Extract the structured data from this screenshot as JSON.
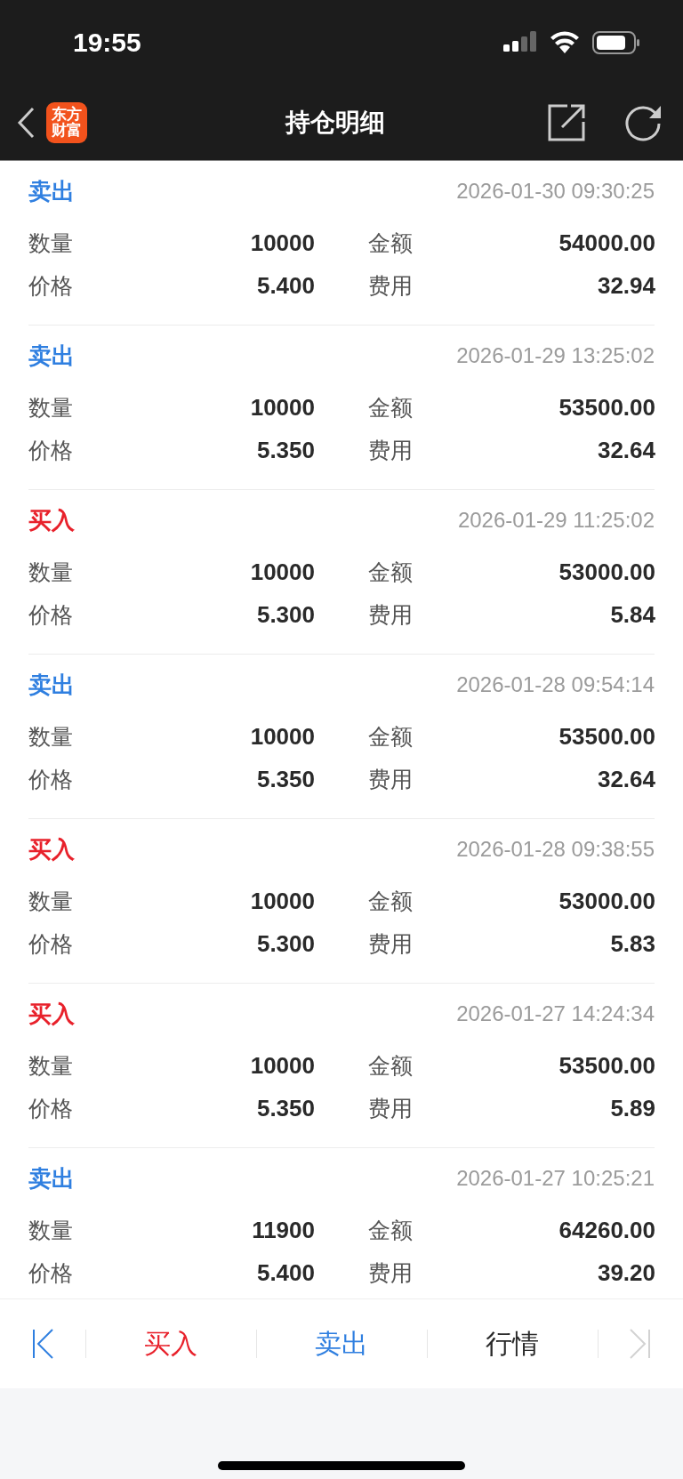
{
  "status_bar": {
    "time": "19:55"
  },
  "header": {
    "logo_lines": [
      "东方",
      "财富"
    ],
    "title": "持仓明细"
  },
  "records": [
    {
      "side": {
        "kind": "sell",
        "label": "卖出"
      },
      "time": "2026-01-30 09:30:25",
      "fields": [
        {
          "label": "数量",
          "value": "10000"
        },
        {
          "label": "金额",
          "value": "54000.00"
        },
        {
          "label": "价格",
          "value": "5.400"
        },
        {
          "label": "费用",
          "value": "32.94"
        }
      ]
    },
    {
      "side": {
        "kind": "sell",
        "label": "卖出"
      },
      "time": "2026-01-29 13:25:02",
      "fields": [
        {
          "label": "数量",
          "value": "10000"
        },
        {
          "label": "金额",
          "value": "53500.00"
        },
        {
          "label": "价格",
          "value": "5.350"
        },
        {
          "label": "费用",
          "value": "32.64"
        }
      ]
    },
    {
      "side": {
        "kind": "buy",
        "label": "买入"
      },
      "time": "2026-01-29 11:25:02",
      "fields": [
        {
          "label": "数量",
          "value": "10000"
        },
        {
          "label": "金额",
          "value": "53000.00"
        },
        {
          "label": "价格",
          "value": "5.300"
        },
        {
          "label": "费用",
          "value": "5.84"
        }
      ]
    },
    {
      "side": {
        "kind": "sell",
        "label": "卖出"
      },
      "time": "2026-01-28 09:54:14",
      "fields": [
        {
          "label": "数量",
          "value": "10000"
        },
        {
          "label": "金额",
          "value": "53500.00"
        },
        {
          "label": "价格",
          "value": "5.350"
        },
        {
          "label": "费用",
          "value": "32.64"
        }
      ]
    },
    {
      "side": {
        "kind": "buy",
        "label": "买入"
      },
      "time": "2026-01-28 09:38:55",
      "fields": [
        {
          "label": "数量",
          "value": "10000"
        },
        {
          "label": "金额",
          "value": "53000.00"
        },
        {
          "label": "价格",
          "value": "5.300"
        },
        {
          "label": "费用",
          "value": "5.83"
        }
      ]
    },
    {
      "side": {
        "kind": "buy",
        "label": "买入"
      },
      "time": "2026-01-27 14:24:34",
      "fields": [
        {
          "label": "数量",
          "value": "10000"
        },
        {
          "label": "金额",
          "value": "53500.00"
        },
        {
          "label": "价格",
          "value": "5.350"
        },
        {
          "label": "费用",
          "value": "5.89"
        }
      ]
    },
    {
      "side": {
        "kind": "sell",
        "label": "卖出"
      },
      "time": "2026-01-27 10:25:21",
      "fields": [
        {
          "label": "数量",
          "value": "11900"
        },
        {
          "label": "金额",
          "value": "64260.00"
        },
        {
          "label": "价格",
          "value": "5.400"
        },
        {
          "label": "费用",
          "value": "39.20"
        }
      ]
    }
  ],
  "bottom_bar": [
    {
      "kind": "first",
      "disabled": false
    },
    {
      "kind": "buy",
      "label": "买入"
    },
    {
      "kind": "sell",
      "label": "卖出"
    },
    {
      "kind": "quote",
      "label": "行情"
    },
    {
      "kind": "last",
      "disabled": true
    }
  ]
}
